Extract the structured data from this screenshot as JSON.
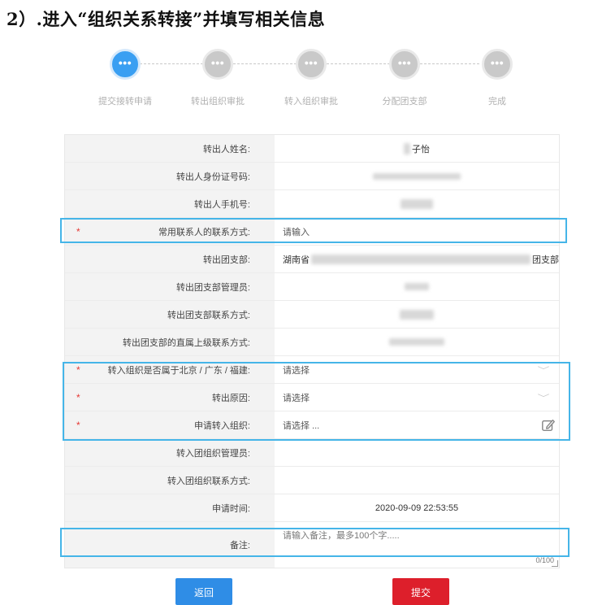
{
  "heading": "2）.进入“组织关系转接”并填写相关信息",
  "steps": [
    {
      "label": "提交接转申请",
      "icon": "ellipsis-icon"
    },
    {
      "label": "转出组织审批",
      "icon": "ellipsis-icon"
    },
    {
      "label": "转入组织审批",
      "icon": "ellipsis-icon"
    },
    {
      "label": "分配团支部",
      "icon": "ellipsis-icon"
    },
    {
      "label": "完成",
      "icon": "ellipsis-icon"
    }
  ],
  "step_icon_glyph": "•••",
  "form": {
    "out_name_label": "转出人姓名:",
    "out_name_value": "子怡",
    "out_id_label": "转出人身份证号码:",
    "out_phone_label": "转出人手机号:",
    "contact_label": "常用联系人的联系方式:",
    "contact_placeholder": "请输入",
    "out_branch_label": "转出团支部:",
    "out_branch_prefix": "湖南省",
    "out_branch_suffix": "团支部",
    "out_admin_label": "转出团支部管理员:",
    "out_branch_contact_label": "转出团支部联系方式:",
    "out_superior_contact_label": "转出团支部的直属上级联系方式:",
    "in_region_label": "转入组织是否属于北京 / 广东 / 福建:",
    "in_region_placeholder": "请选择",
    "reason_label": "转出原因:",
    "reason_placeholder": "请选择",
    "apply_org_label": "申请转入组织:",
    "apply_org_placeholder": "请选择 ...",
    "in_admin_label": "转入团组织管理员:",
    "in_contact_label": "转入团组织联系方式:",
    "apply_time_label": "申请时间:",
    "apply_time_value": "2020-09-09 22:53:55",
    "remark_label": "备注:",
    "remark_placeholder": "请输入备注，最多100个字.....",
    "remark_counter": "0/100",
    "required_mark": "*"
  },
  "buttons": {
    "back": "返回",
    "submit": "提交"
  },
  "colors": {
    "primary": "#3a9ff2",
    "highlight": "#45b5e8",
    "submit": "#dd1f2b",
    "back": "#2f8de6",
    "required": "#e53935"
  }
}
